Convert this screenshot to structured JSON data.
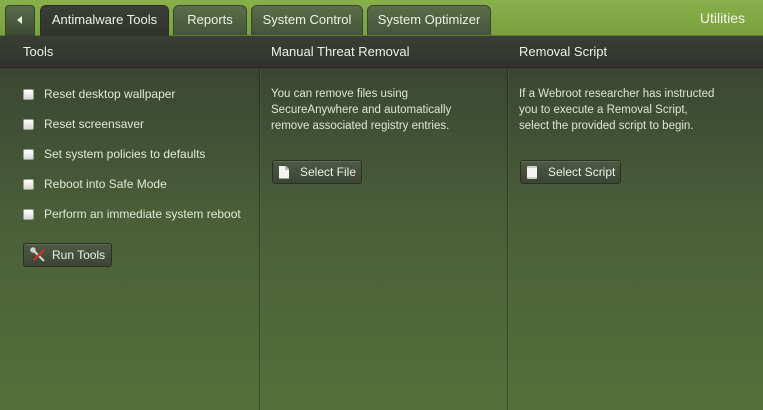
{
  "tabs": [
    {
      "label": "Antimalware Tools",
      "active": true
    },
    {
      "label": "Reports",
      "active": false
    },
    {
      "label": "System Control",
      "active": false
    },
    {
      "label": "System Optimizer",
      "active": false
    }
  ],
  "header": {
    "utilities_label": "Utilities"
  },
  "columns": {
    "tools": {
      "title": "Tools",
      "options": [
        {
          "label": "Reset desktop wallpaper",
          "checked": false
        },
        {
          "label": "Reset screensaver",
          "checked": false
        },
        {
          "label": "Set system policies to defaults",
          "checked": false
        },
        {
          "label": "Reboot into Safe Mode",
          "checked": false
        },
        {
          "label": "Perform an immediate system reboot",
          "checked": false
        }
      ],
      "run_button": {
        "label": "Run Tools",
        "icon": "tools-icon"
      }
    },
    "manual": {
      "title": "Manual Threat Removal",
      "description": [
        "You can remove files using",
        "SecureAnywhere and automatically",
        "remove associated registry entries."
      ],
      "button": {
        "label": "Select File",
        "icon": "file-icon"
      }
    },
    "script": {
      "title": "Removal Script",
      "description": [
        "If a Webroot researcher has instructed",
        "you to execute a Removal Script,",
        "select the provided script to begin."
      ],
      "button": {
        "label": "Select Script",
        "icon": "script-icon"
      }
    }
  },
  "colors": {
    "accent_green": "#79a23c",
    "panel_dark": "#30332d"
  }
}
